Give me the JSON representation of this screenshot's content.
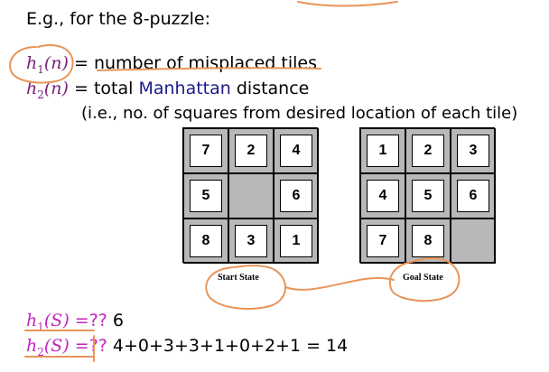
{
  "heading": "E.g., for the 8-puzzle:",
  "h1": {
    "lhs_f": "h",
    "lhs_sub": "1",
    "lhs_arg": "(n)",
    "eq": " = ",
    "rhs": "number of misplaced tiles"
  },
  "h2": {
    "lhs_f": "h",
    "lhs_sub": "2",
    "lhs_arg": "(n)",
    "eq": " = ",
    "rhs_a": "total ",
    "rhs_b": "Manhattan",
    "rhs_c": " distance"
  },
  "note": "(i.e., no. of squares from desired location of each tile)",
  "start_board": {
    "caption": "Start State",
    "tiles": [
      "7",
      "2",
      "4",
      "5",
      "",
      "6",
      "8",
      "3",
      "1"
    ]
  },
  "goal_board": {
    "caption": "Goal State",
    "tiles": [
      "1",
      "2",
      "3",
      "4",
      "5",
      "6",
      "7",
      "8",
      ""
    ]
  },
  "q1": {
    "lhs_f": "h",
    "lhs_sub": "1",
    "lhs_arg": "(S)",
    "eq": " =?? ",
    "answer": "6"
  },
  "q2": {
    "lhs_f": "h",
    "lhs_sub": "2",
    "lhs_arg": "(S)",
    "eq": " =?? ",
    "answer": "4+0+3+3+1+0+2+1 = 14"
  },
  "colors": {
    "purple": "#7a1f7a",
    "magenta": "#c025c0",
    "navy": "#1a1a8a",
    "ink": "#e8955a",
    "tile_bg": "#ffffff",
    "blank": "#b8b8b8"
  }
}
